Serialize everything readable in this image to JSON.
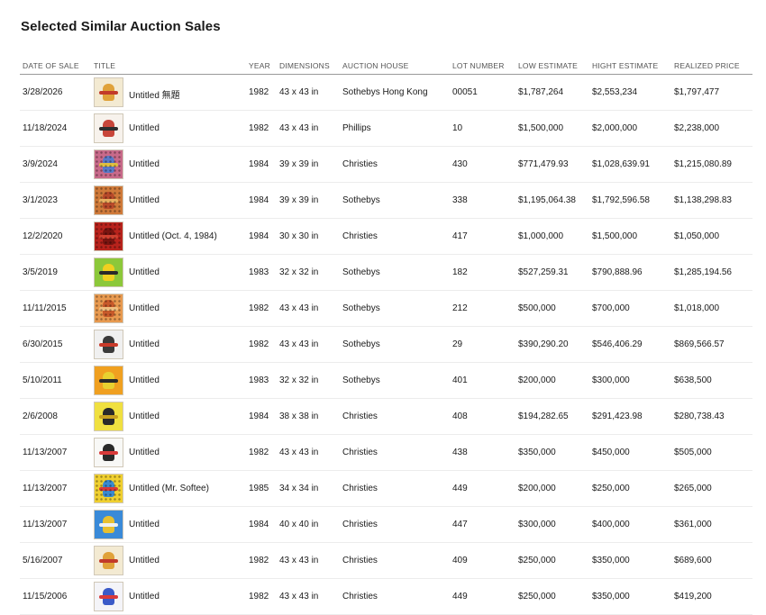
{
  "page": {
    "title": "Selected Similar Auction Sales"
  },
  "columns": {
    "date": "DATE OF SALE",
    "title": "TITLE",
    "year": "YEAR",
    "dimensions": "DIMENSIONS",
    "house": "AUCTION HOUSE",
    "lot": "LOT NUMBER",
    "low": "LOW ESTIMATE",
    "high": "HIGHT ESTIMATE",
    "realized": "REALIZED PRICE"
  },
  "rows": [
    {
      "date": "3/28/2026",
      "title": "Untitled 無題",
      "year": "1982",
      "dimensions": "43 x 43 in",
      "house": "Sothebys Hong Kong",
      "lot": "00051",
      "low": "$1,787,264",
      "high": "$2,553,234",
      "realized": "$1,797,477",
      "thumb": {
        "bg": "#f3ead2",
        "fig": "#e0a23a",
        "fig2": "#c23a2a",
        "dots": false
      }
    },
    {
      "date": "11/18/2024",
      "title": "Untitled",
      "year": "1982",
      "dimensions": "43 x 43 in",
      "house": "Phillips",
      "lot": "10",
      "low": "$1,500,000",
      "high": "$2,000,000",
      "realized": "$2,238,000",
      "thumb": {
        "bg": "#f7f2ec",
        "fig": "#c8463a",
        "fig2": "#2e2e2e",
        "dots": false
      }
    },
    {
      "date": "3/9/2024",
      "title": "Untitled",
      "year": "1984",
      "dimensions": "39 x 39 in",
      "house": "Christies",
      "lot": "430",
      "low": "$771,479.93",
      "high": "$1,028,639.91",
      "realized": "$1,215,080.89",
      "thumb": {
        "bg": "#c86a8a",
        "fig": "#5a7ac8",
        "fig2": "#e0c040",
        "dots": true
      }
    },
    {
      "date": "3/1/2023",
      "title": "Untitled",
      "year": "1984",
      "dimensions": "39 x 39 in",
      "house": "Sothebys",
      "lot": "338",
      "low": "$1,195,064.38",
      "high": "$1,792,596.58",
      "realized": "$1,138,298.83",
      "thumb": {
        "bg": "#d07a3a",
        "fig": "#b84a2a",
        "fig2": "#e8b060",
        "dots": true
      }
    },
    {
      "date": "12/2/2020",
      "title": "Untitled (Oct. 4, 1984)",
      "year": "1984",
      "dimensions": "30 x 30 in",
      "house": "Christies",
      "lot": "417",
      "low": "$1,000,000",
      "high": "$1,500,000",
      "realized": "$1,050,000",
      "thumb": {
        "bg": "#b8231c",
        "fig": "#7a1410",
        "fig2": "#d04030",
        "dots": true
      }
    },
    {
      "date": "3/5/2019",
      "title": "Untitled",
      "year": "1983",
      "dimensions": "32 x 32 in",
      "house": "Sothebys",
      "lot": "182",
      "low": "$527,259.31",
      "high": "$790,888.96",
      "realized": "$1,285,194.56",
      "thumb": {
        "bg": "#8cc83a",
        "fig": "#f0d020",
        "fig2": "#2a2a2a",
        "dots": false
      }
    },
    {
      "date": "11/11/2015",
      "title": "Untitled",
      "year": "1982",
      "dimensions": "43 x 43 in",
      "house": "Sothebys",
      "lot": "212",
      "low": "$500,000",
      "high": "$700,000",
      "realized": "$1,018,000",
      "thumb": {
        "bg": "#e89a50",
        "fig": "#c85a2a",
        "fig2": "#f0c080",
        "dots": true
      }
    },
    {
      "date": "6/30/2015",
      "title": "Untitled",
      "year": "1982",
      "dimensions": "43 x 43 in",
      "house": "Sothebys",
      "lot": "29",
      "low": "$390,290.20",
      "high": "$546,406.29",
      "realized": "$869,566.57",
      "thumb": {
        "bg": "#f0f0f0",
        "fig": "#3a3a3a",
        "fig2": "#c83a2a",
        "dots": false
      }
    },
    {
      "date": "5/10/2011",
      "title": "Untitled",
      "year": "1983",
      "dimensions": "32 x 32 in",
      "house": "Sothebys",
      "lot": "401",
      "low": "$200,000",
      "high": "$300,000",
      "realized": "$638,500",
      "thumb": {
        "bg": "#f0a020",
        "fig": "#e8d030",
        "fig2": "#2a2a2a",
        "dots": false
      }
    },
    {
      "date": "2/6/2008",
      "title": "Untitled",
      "year": "1984",
      "dimensions": "38 x 38 in",
      "house": "Christies",
      "lot": "408",
      "low": "$194,282.65",
      "high": "$291,423.98",
      "realized": "$280,738.43",
      "thumb": {
        "bg": "#f0e040",
        "fig": "#2a2a2a",
        "fig2": "#c8a020",
        "dots": false
      }
    },
    {
      "date": "11/13/2007",
      "title": "Untitled",
      "year": "1982",
      "dimensions": "43 x 43 in",
      "house": "Christies",
      "lot": "438",
      "low": "$350,000",
      "high": "$450,000",
      "realized": "$505,000",
      "thumb": {
        "bg": "#f8f8f6",
        "fig": "#2a2a2a",
        "fig2": "#d83a3a",
        "dots": false
      }
    },
    {
      "date": "11/13/2007",
      "title": "Untitled (Mr. Softee)",
      "year": "1985",
      "dimensions": "34 x 34 in",
      "house": "Christies",
      "lot": "449",
      "low": "$200,000",
      "high": "$250,000",
      "realized": "$265,000",
      "thumb": {
        "bg": "#f0d030",
        "fig": "#3a8ad0",
        "fig2": "#d83a3a",
        "dots": true
      }
    },
    {
      "date": "11/13/2007",
      "title": "Untitled",
      "year": "1984",
      "dimensions": "40 x 40 in",
      "house": "Christies",
      "lot": "447",
      "low": "$300,000",
      "high": "$400,000",
      "realized": "$361,000",
      "thumb": {
        "bg": "#3a8ad8",
        "fig": "#e8c030",
        "fig2": "#f0f0f0",
        "dots": false
      }
    },
    {
      "date": "5/16/2007",
      "title": "Untitled",
      "year": "1982",
      "dimensions": "43 x 43 in",
      "house": "Christies",
      "lot": "409",
      "low": "$250,000",
      "high": "$350,000",
      "realized": "$689,600",
      "thumb": {
        "bg": "#f3ead2",
        "fig": "#e0a23a",
        "fig2": "#c23a2a",
        "dots": false
      }
    },
    {
      "date": "11/15/2006",
      "title": "Untitled",
      "year": "1982",
      "dimensions": "43 x 43 in",
      "house": "Christies",
      "lot": "449",
      "low": "$250,000",
      "high": "$350,000",
      "realized": "$419,200",
      "thumb": {
        "bg": "#f4f4f8",
        "fig": "#3a5ac8",
        "fig2": "#d83a3a",
        "dots": false
      }
    }
  ]
}
